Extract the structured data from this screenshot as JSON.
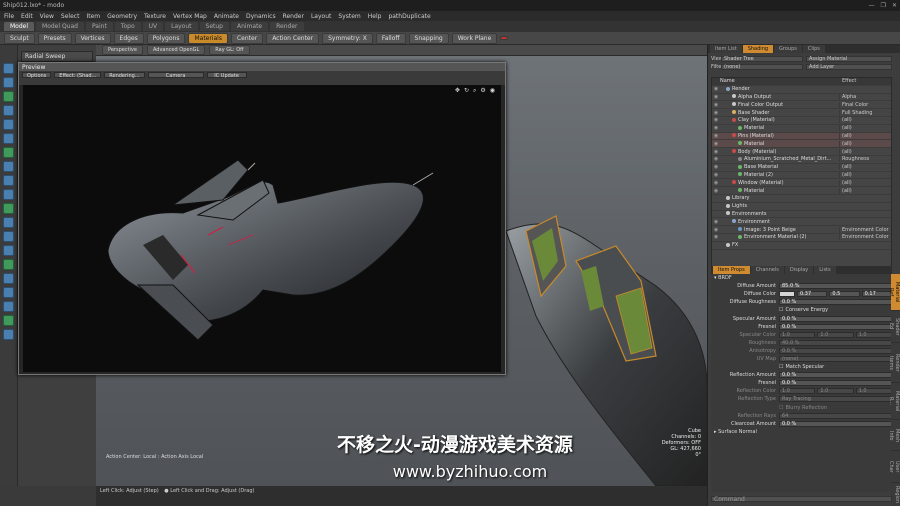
{
  "window": {
    "title": "Ship012.lxo* - modo",
    "controls": [
      "—",
      "❐",
      "✕"
    ]
  },
  "menu": [
    "File",
    "Edit",
    "View",
    "Select",
    "Item",
    "Geometry",
    "Texture",
    "Vertex Map",
    "Animate",
    "Dynamics",
    "Render",
    "Layout",
    "System",
    "Help",
    "pathDuplicate"
  ],
  "tabs": [
    "Model",
    "Model Quad",
    "Paint",
    "Topo",
    "UV",
    "Layout",
    "Setup",
    "Animate",
    "Render"
  ],
  "toolbar": [
    "Sculpt",
    "Presets",
    "Vertices",
    "Edges",
    "Polygons",
    "Materials",
    "Center",
    "Action Center",
    "Symmetry: X",
    "Falloff",
    "Snapping",
    "Work Plane"
  ],
  "left_panel": {
    "tab": "Radial Sweep"
  },
  "viewport_header": [
    "Perspective",
    "Advanced OpenGL",
    "Ray GL: Off"
  ],
  "preview": {
    "title": "Preview",
    "options": [
      "Options",
      "Effect: (Shad...",
      "Rendering...",
      "Camera",
      "IC Update"
    ]
  },
  "right_panel": {
    "tabs": [
      "Item List",
      "Shading",
      "Groups",
      "Clips"
    ],
    "view_label": "View",
    "view_value": "Shader Tree",
    "filter_label": "Filter",
    "filter_value": "(none)",
    "assign_material": "Assign Material",
    "add_layer": "Add Layer",
    "tree_header": [
      "Name",
      "Effect"
    ],
    "tree": [
      {
        "name": "Render",
        "effect": "",
        "indent": 1,
        "color": "#8aa6c8"
      },
      {
        "name": "Alpha Output",
        "effect": "Alpha",
        "indent": 2,
        "color": "#c8c8c8"
      },
      {
        "name": "Final Color Output",
        "effect": "Final Color",
        "indent": 2,
        "color": "#c8c8c8"
      },
      {
        "name": "Base Shader",
        "effect": "Full Shading",
        "indent": 2,
        "color": "#d8b060"
      },
      {
        "name": "Clay (Material)",
        "effect": "(all)",
        "indent": 2,
        "color": "#c84a4a"
      },
      {
        "name": "Material",
        "effect": "(all)",
        "indent": 3,
        "color": "#6ab86a"
      },
      {
        "name": "Pins (Material)",
        "effect": "(all)",
        "indent": 2,
        "color": "#c84a4a",
        "sel": true
      },
      {
        "name": "Material",
        "effect": "(all)",
        "indent": 3,
        "color": "#6ab86a",
        "sel": true
      },
      {
        "name": "Body (Material)",
        "effect": "(all)",
        "indent": 2,
        "color": "#c84a4a"
      },
      {
        "name": "Aluminium_Scratched_Metal_Dirt...",
        "effect": "Roughness",
        "indent": 3,
        "color": "#8a8a8a"
      },
      {
        "name": "Base Material",
        "effect": "(all)",
        "indent": 3,
        "color": "#6ab86a"
      },
      {
        "name": "Material (2)",
        "effect": "(all)",
        "indent": 3,
        "color": "#6ab86a"
      },
      {
        "name": "Window (Material)",
        "effect": "(all)",
        "indent": 2,
        "color": "#c84a4a"
      },
      {
        "name": "Material",
        "effect": "(all)",
        "indent": 3,
        "color": "#6ab86a"
      },
      {
        "name": "Library",
        "effect": "",
        "indent": 1,
        "color": "#c8c8c8"
      },
      {
        "name": "Lights",
        "effect": "",
        "indent": 1,
        "color": "#c8c8c8"
      },
      {
        "name": "Environments",
        "effect": "",
        "indent": 1,
        "color": "#c8c8c8"
      },
      {
        "name": "Environment",
        "effect": "",
        "indent": 2,
        "color": "#8aa6c8"
      },
      {
        "name": "Image: 3 Point Beige",
        "effect": "Environment Color",
        "indent": 3,
        "color": "#6a9ac8"
      },
      {
        "name": "Environment Material (2)",
        "effect": "Environment Color",
        "indent": 3,
        "color": "#6ab86a"
      },
      {
        "name": "FX",
        "effect": "",
        "indent": 1,
        "color": "#c8c8c8"
      }
    ],
    "prop_tabs": [
      "Item Props",
      "Channels",
      "Display",
      "Lists"
    ],
    "props_section": "BRDF",
    "props": [
      {
        "label": "Diffuse Amount",
        "value": "85.0 %"
      },
      {
        "label": "Diffuse Color",
        "values": [
          "0.37",
          "0.5",
          "0.17"
        ],
        "color": "#d6d6d6"
      },
      {
        "label": "Diffuse Roughness",
        "value": "0.0 %"
      },
      {
        "label": "",
        "check": "Conserve Energy"
      },
      {
        "label": "Specular Amount",
        "value": "0.0 %"
      },
      {
        "label": "Fresnel",
        "value": "0.0 %"
      },
      {
        "label": "Specular Color",
        "values": [
          "1.0",
          "1.0",
          "1.0"
        ],
        "dim": true
      },
      {
        "label": "Roughness",
        "value": "40.0 %",
        "dim": true
      },
      {
        "label": "Anisotropy",
        "value": "0.0 %",
        "dim": true
      },
      {
        "label": "UV Map",
        "value": "(none)",
        "dim": true
      },
      {
        "label": "",
        "check": "Match Specular"
      },
      {
        "label": "Reflection Amount",
        "value": "0.0 %"
      },
      {
        "label": "Fresnel",
        "value": "0.0 %"
      },
      {
        "label": "Reflection Color",
        "values": [
          "1.0",
          "1.0",
          "1.0"
        ],
        "dim": true
      },
      {
        "label": "Reflection Type",
        "value": "Ray Tracing",
        "dim": true
      },
      {
        "label": "",
        "check": "Blurry Reflection",
        "dim": true
      },
      {
        "label": "Reflection Rays",
        "value": "64",
        "dim": true
      },
      {
        "label": "Clearcoat Amount",
        "value": "0.0 %"
      }
    ],
    "surface_normal": "Surface Normal",
    "side_tabs": [
      "Material Ref",
      "Shader Ed",
      "Render Items",
      "Material R...",
      "Mesh Info",
      "User Char",
      "Region"
    ],
    "command_field": "Command"
  },
  "viewport_stats": [
    "Cube",
    "Channels: 0",
    "Deformers: OFF",
    "GL: 427,660",
    "0°"
  ],
  "viewport_axis_hint": "Action Center: Local : Action Axis Local",
  "status": [
    "Left Click: Adjust (Step)",
    "Left Click and Drag: Adjust (Drag)"
  ],
  "watermark": {
    "cn": "不移之火-动漫游戏美术资源",
    "url": "www.byzhihuo.com"
  }
}
